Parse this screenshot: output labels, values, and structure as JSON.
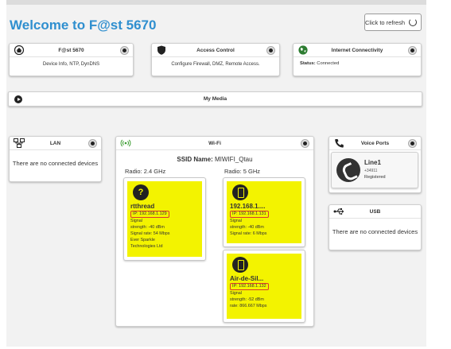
{
  "page": {
    "title": "Welcome to F@st 5670",
    "refresh_label": "Click to refresh"
  },
  "cards": {
    "fast": {
      "title": "F@st 5670",
      "desc": "Device Info, NTP, DynDNS"
    },
    "access": {
      "title": "Access Control",
      "desc": "Configure Firewall, DMZ, Remote Access."
    },
    "internet": {
      "title": "Internet Connectivity",
      "status_label": "Status:",
      "status_value": "Connected"
    },
    "media": {
      "title": "My Media"
    },
    "lan": {
      "title": "LAN",
      "empty": "There are no connected devices"
    },
    "wifi": {
      "title": "Wi-Fi",
      "ssid_label": "SSID Name:",
      "ssid_value": "MIWIFI_Qtau",
      "radio_24": "Radio: 2.4 GHz",
      "radio_5": "Radio: 5 GHz",
      "devices": [
        {
          "name": "rtthread",
          "ip": "IP: 192.168.1.129",
          "signal": "Signal",
          "strength": "strength: -40 dBm",
          "rate": "Signal rate: 54 Mbps",
          "vendor1": "Ever Sparkle",
          "vendor2": "Technologies Ltd",
          "icon": "question-icon"
        },
        {
          "name": "192.168.1....",
          "ip": "IP: 192.168.1.131",
          "signal": "Signal",
          "strength": "strength: -40 dBm",
          "rate": "Signal rate: 6 Mbps",
          "icon": "phone-device-icon"
        },
        {
          "name": "Air-de-Sil...",
          "ip": "IP: 192.168.1.132",
          "signal": "Signal",
          "strength": "strength: -52 dBm",
          "rate": "rate: 866.667 Mbps",
          "icon": "phone-device-icon"
        }
      ]
    },
    "voice": {
      "title": "Voice Ports",
      "line_name": "Line1",
      "line_number": "+34911",
      "line_status": "Registered"
    },
    "usb": {
      "title": "USB",
      "empty": "There are no connected devices"
    }
  },
  "colors": {
    "title_blue": "#2f8fcf",
    "device_yellow": "#f3f300",
    "ip_highlight": "#d93a2f"
  }
}
